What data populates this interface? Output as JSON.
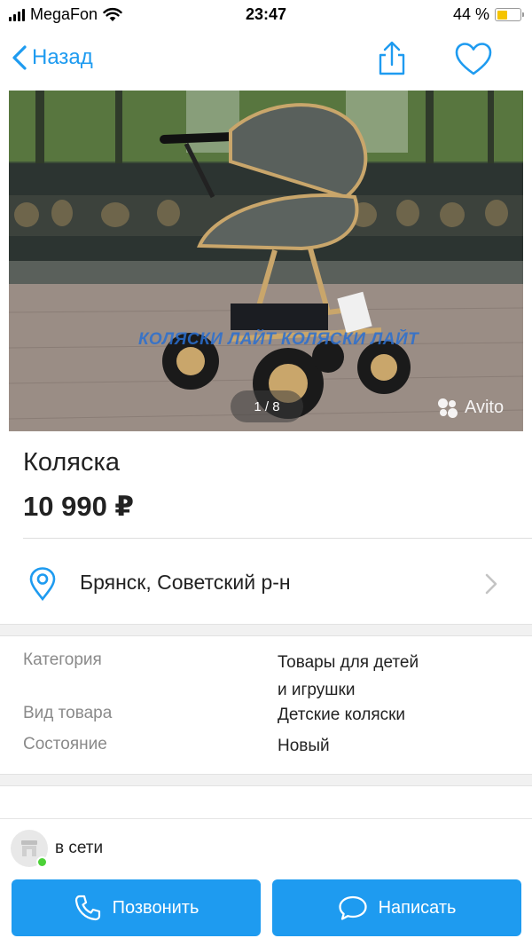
{
  "status_bar": {
    "carrier": "MegaFon",
    "time": "23:47",
    "battery_text": "44 %",
    "battery_level": 0.44,
    "battery_color": "#f5c400"
  },
  "nav": {
    "back_label": "Назад",
    "share_icon": "share-icon",
    "favorite_icon": "heart-icon",
    "accent_color": "#1e9bf0"
  },
  "gallery": {
    "counter": "1 / 8",
    "current": 1,
    "total": 8,
    "watermark": "Avito",
    "overlay_text": "КОЛЯСКИ ЛАЙТ КОЛЯСКИ ЛАЙТ"
  },
  "listing": {
    "title": "Коляска",
    "price": "10 990 ₽"
  },
  "location": {
    "text": "Брянск, Советский р-н",
    "icon": "map-pin-icon"
  },
  "params": [
    {
      "label": "Категория",
      "value_lines": [
        "Товары для детей",
        "и игрушки"
      ]
    },
    {
      "label": "Вид товара",
      "value_lines": [
        "Детские коляски"
      ]
    },
    {
      "label": "Состояние",
      "value_lines": [
        "Новый"
      ]
    }
  ],
  "seller": {
    "status": "в сети",
    "online_color": "#4cd137"
  },
  "actions": {
    "call_label": "Позвонить",
    "message_label": "Написать",
    "button_color": "#1e9bf0"
  }
}
